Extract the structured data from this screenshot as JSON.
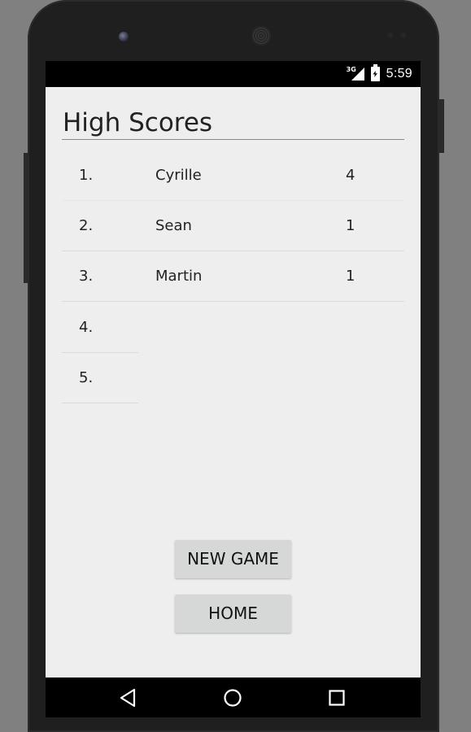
{
  "status_bar": {
    "network_label": "3G",
    "time": "5:59"
  },
  "screen": {
    "title": "High Scores",
    "scores": [
      {
        "rank": "1.",
        "name": "Cyrille",
        "score": "4"
      },
      {
        "rank": "2.",
        "name": "Sean",
        "score": "1"
      },
      {
        "rank": "3.",
        "name": "Martin",
        "score": "1"
      },
      {
        "rank": "4.",
        "name": "",
        "score": ""
      },
      {
        "rank": "5.",
        "name": "",
        "score": ""
      }
    ],
    "buttons": {
      "new_game": "NEW GAME",
      "home": "HOME"
    }
  },
  "nav_bar": {
    "icons": [
      "back-icon",
      "home-circle-icon",
      "recents-icon"
    ]
  },
  "colors": {
    "screen_bg": "#eeeeee",
    "button_bg": "#d6d7d7",
    "system_bar": "#000000",
    "phone_frame": "#1f1f1f",
    "outer_bg": "#808080"
  }
}
